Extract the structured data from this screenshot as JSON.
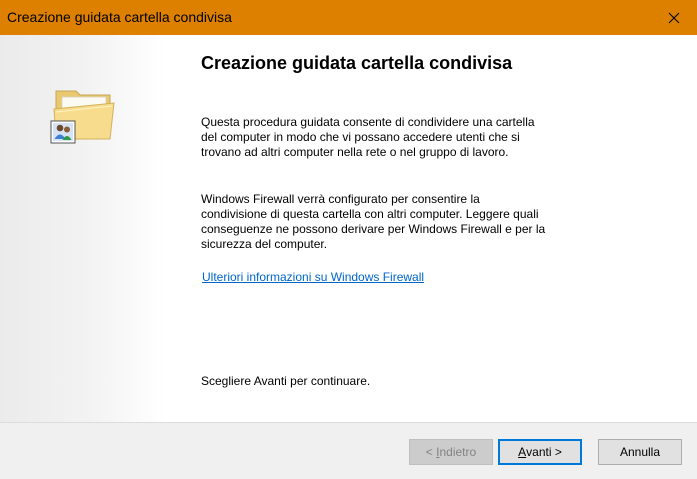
{
  "window": {
    "title": "Creazione guidata cartella condivisa"
  },
  "main": {
    "heading": "Creazione guidata cartella condivisa",
    "paragraph1": "Questa procedura guidata consente di condividere una cartella del computer in modo che vi possano accedere utenti che si trovano ad altri computer nella rete o nel gruppo di lavoro.",
    "paragraph2": "Windows Firewall verrà configurato per consentire la condivisione di questa cartella con altri computer. Leggere quali conseguenze ne possono derivare per Windows Firewall e per la sicurezza del computer.",
    "link": "Ulteriori informazioni su Windows Firewall",
    "continue_text": "Scegliere Avanti per continuare."
  },
  "buttons": {
    "back": {
      "underline": "I",
      "rest": "ndietro",
      "prefix": "< ",
      "disabled": true
    },
    "next": {
      "underline": "A",
      "rest": "vanti",
      "suffix": " >"
    },
    "cancel": "Annulla"
  },
  "icons": {
    "close": "close-icon",
    "side": "shared-folder-icon"
  },
  "colors": {
    "titlebar": "#dd8000",
    "link": "#0066cc",
    "default_button_border": "#0078d7"
  }
}
